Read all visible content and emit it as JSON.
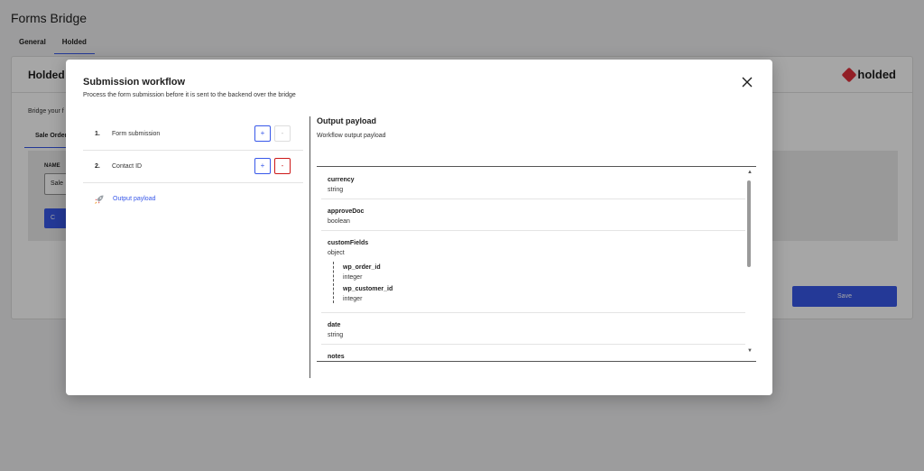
{
  "app": {
    "title": "Forms Bridge",
    "tabs": [
      {
        "label": "General",
        "active": false
      },
      {
        "label": "Holded",
        "active": true
      }
    ]
  },
  "background": {
    "card_title": "Holded",
    "logo_text": "holded",
    "description": "Bridge your f",
    "subtab": "Sale Order",
    "name_label": "NAME",
    "name_value": "Sale",
    "button_label": "C",
    "save_label": "Save"
  },
  "modal": {
    "title": "Submission workflow",
    "subtitle": "Process the form submission before it is sent to the backend over the bridge",
    "steps": [
      {
        "num": "1.",
        "label": "Form submission",
        "plus": "+",
        "minus": "-"
      },
      {
        "num": "2.",
        "label": "Contact ID",
        "plus": "+",
        "minus": "-"
      }
    ],
    "output_link": "Output payload",
    "output": {
      "title": "Output payload",
      "subtitle": "Workflow output payload",
      "fields": [
        {
          "name": "currency",
          "type": "string"
        },
        {
          "name": "approveDoc",
          "type": "boolean"
        },
        {
          "name": "customFields",
          "type": "object",
          "children": [
            {
              "name": "wp_order_id",
              "type": "integer"
            },
            {
              "name": "wp_customer_id",
              "type": "integer"
            }
          ]
        },
        {
          "name": "date",
          "type": "string"
        },
        {
          "name": "notes",
          "type": ""
        }
      ]
    }
  },
  "colors": {
    "accent": "#3858e9",
    "danger": "#cc1818",
    "brand_red": "#e0313b"
  }
}
